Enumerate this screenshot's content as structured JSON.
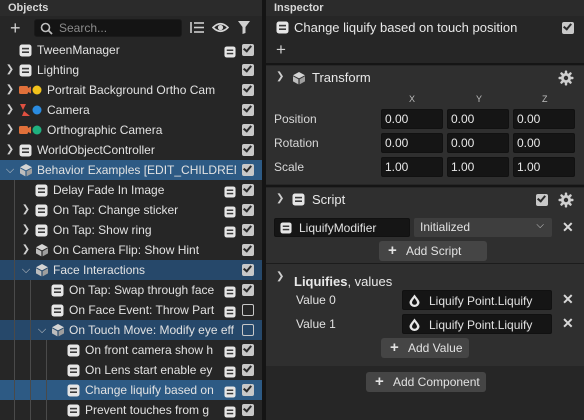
{
  "objects": {
    "title": "Objects",
    "search_placeholder": "Search...",
    "rows": [
      {
        "label": "TweenManager",
        "depth": 0,
        "expander": "none",
        "icon": "object-box-icon",
        "script": true,
        "checked": true,
        "state": ""
      },
      {
        "label": "Lighting",
        "depth": 0,
        "expander": "collapsed",
        "icon": "object-box-icon",
        "script": false,
        "checked": true,
        "state": ""
      },
      {
        "label": "Portrait Background Ortho Cam",
        "depth": 0,
        "expander": "collapsed",
        "icon": "camera-yellow-icon",
        "script": false,
        "checked": true,
        "state": ""
      },
      {
        "label": "Camera",
        "depth": 0,
        "expander": "collapsed",
        "icon": "camera-blue-icon",
        "script": false,
        "checked": true,
        "state": ""
      },
      {
        "label": "Orthographic Camera",
        "depth": 0,
        "expander": "collapsed",
        "icon": "camera-green-icon",
        "script": false,
        "checked": true,
        "state": ""
      },
      {
        "label": "WorldObjectController",
        "depth": 0,
        "expander": "collapsed",
        "icon": "object-box-icon",
        "script": false,
        "checked": true,
        "state": ""
      },
      {
        "label": "Behavior Examples [EDIT_CHILDREN]",
        "depth": 0,
        "expander": "expanded",
        "icon": "cube-icon",
        "script": false,
        "checked": true,
        "state": "sel"
      },
      {
        "label": "Delay Fade In Image",
        "depth": 1,
        "expander": "none",
        "icon": "object-box-icon",
        "script": true,
        "checked": true,
        "state": ""
      },
      {
        "label": "On Tap: Change sticker",
        "depth": 1,
        "expander": "collapsed",
        "icon": "object-box-icon",
        "script": true,
        "checked": true,
        "state": ""
      },
      {
        "label": "On Tap: Show ring",
        "depth": 1,
        "expander": "collapsed",
        "icon": "object-box-icon",
        "script": true,
        "checked": true,
        "state": ""
      },
      {
        "label": "On Camera Flip: Show Hint",
        "depth": 1,
        "expander": "collapsed",
        "icon": "cube-icon",
        "script": false,
        "checked": true,
        "state": ""
      },
      {
        "label": "Face Interactions",
        "depth": 1,
        "expander": "expanded",
        "icon": "cube-icon",
        "script": false,
        "checked": true,
        "state": "sel-dim"
      },
      {
        "label": "On Tap: Swap through face",
        "depth": 2,
        "expander": "none",
        "icon": "object-box-icon",
        "script": true,
        "checked": true,
        "state": ""
      },
      {
        "label": "On Face Event: Throw Part",
        "depth": 2,
        "expander": "none",
        "icon": "object-box-icon",
        "script": true,
        "checked": false,
        "state": ""
      },
      {
        "label": "On Touch Move: Modify eye eff",
        "depth": 2,
        "expander": "expanded",
        "icon": "cube-icon",
        "script": false,
        "checked": false,
        "state": "sel-dim"
      },
      {
        "label": "On front camera show h",
        "depth": 3,
        "expander": "none",
        "icon": "object-box-icon",
        "script": true,
        "checked": true,
        "state": ""
      },
      {
        "label": "On Lens start enable ey",
        "depth": 3,
        "expander": "none",
        "icon": "object-box-icon",
        "script": true,
        "checked": true,
        "state": ""
      },
      {
        "label": "Change liquify based on",
        "depth": 3,
        "expander": "none",
        "icon": "object-box-icon",
        "script": true,
        "checked": true,
        "state": "sel"
      },
      {
        "label": "Prevent touches from g",
        "depth": 3,
        "expander": "none",
        "icon": "object-box-icon",
        "script": true,
        "checked": true,
        "state": ""
      }
    ]
  },
  "inspector": {
    "title": "Inspector",
    "object_name": "Change liquify based on touch position",
    "object_enabled": true,
    "transform": {
      "title": "Transform",
      "axes": [
        "X",
        "Y",
        "Z"
      ],
      "rows": [
        {
          "label": "Position",
          "values": [
            "0.00",
            "0.00",
            "0.00"
          ]
        },
        {
          "label": "Rotation",
          "values": [
            "0.00",
            "0.00",
            "0.00"
          ]
        },
        {
          "label": "Scale",
          "values": [
            "1.00",
            "1.00",
            "1.00"
          ]
        }
      ]
    },
    "script": {
      "title": "Script",
      "enabled": true,
      "asset": "LiquifyModifier",
      "state": "Initialized",
      "add_script_label": "Add Script",
      "liquifies_label": "Liquifies",
      "liquifies_suffix": ", values",
      "values": [
        {
          "label": "Value 0",
          "target": "Liquify Point.Liquify"
        },
        {
          "label": "Value 1",
          "target": "Liquify Point.Liquify"
        }
      ],
      "add_value_label": "Add Value"
    },
    "add_component_label": "Add Component"
  }
}
